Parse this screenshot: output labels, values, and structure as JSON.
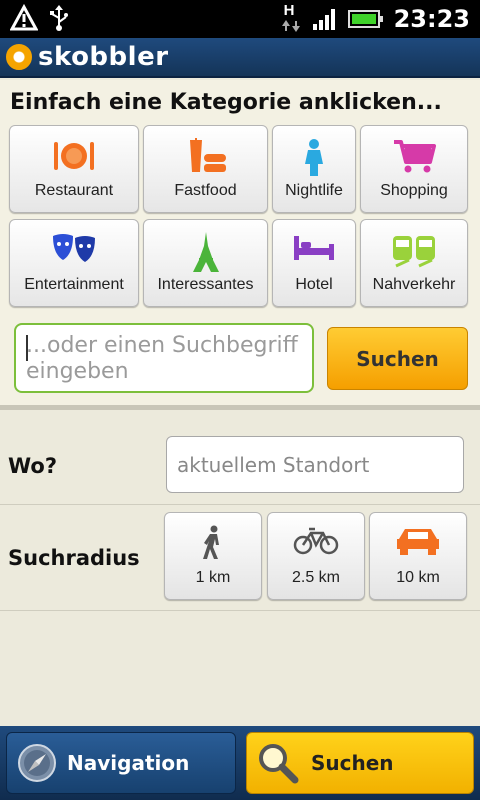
{
  "status_bar": {
    "time": "23:23",
    "network_type": "H",
    "icons": [
      "warning-icon",
      "usb-icon",
      "data-arrows-icon",
      "signal-icon",
      "battery-icon"
    ]
  },
  "app": {
    "brand": "skobbler",
    "brand_color": "#f5a400",
    "header_color": "#1f4a7d"
  },
  "categories_panel": {
    "heading": "Einfach eine Kategorie anklicken...",
    "items": [
      {
        "label": "Restaurant",
        "icon": "restaurant-plate-icon",
        "color": "#f37021"
      },
      {
        "label": "Fastfood",
        "icon": "fastfood-icon",
        "color": "#f37021"
      },
      {
        "label": "Nightlife",
        "icon": "nightlife-person-icon",
        "color": "#2aa9e0"
      },
      {
        "label": "Shopping",
        "icon": "shopping-cart-icon",
        "color": "#d63aa8"
      },
      {
        "label": "Entertainment",
        "icon": "theater-masks-icon",
        "color": "#2c4fd6"
      },
      {
        "label": "Interessantes",
        "icon": "eiffel-tower-icon",
        "color": "#4bb43a"
      },
      {
        "label": "Hotel",
        "icon": "hotel-bed-icon",
        "color": "#8a3fc4"
      },
      {
        "label": "Nahverkehr",
        "icon": "train-icon",
        "color": "#9ad23b"
      }
    ],
    "search_placeholder": "...oder einen Suchbegriff eingeben",
    "search_button": "Suchen"
  },
  "location": {
    "label": "Wo?",
    "placeholder": "aktuellem Standort"
  },
  "radius": {
    "label": "Suchradius",
    "options": [
      {
        "label": "1 km",
        "icon": "walking-person-icon"
      },
      {
        "label": "2.5 km",
        "icon": "bicycle-icon"
      },
      {
        "label": "10 km",
        "icon": "car-icon"
      }
    ],
    "selected_color": "#f37021"
  },
  "bottom_nav": {
    "navigation_label": "Navigation",
    "search_label": "Suchen"
  }
}
